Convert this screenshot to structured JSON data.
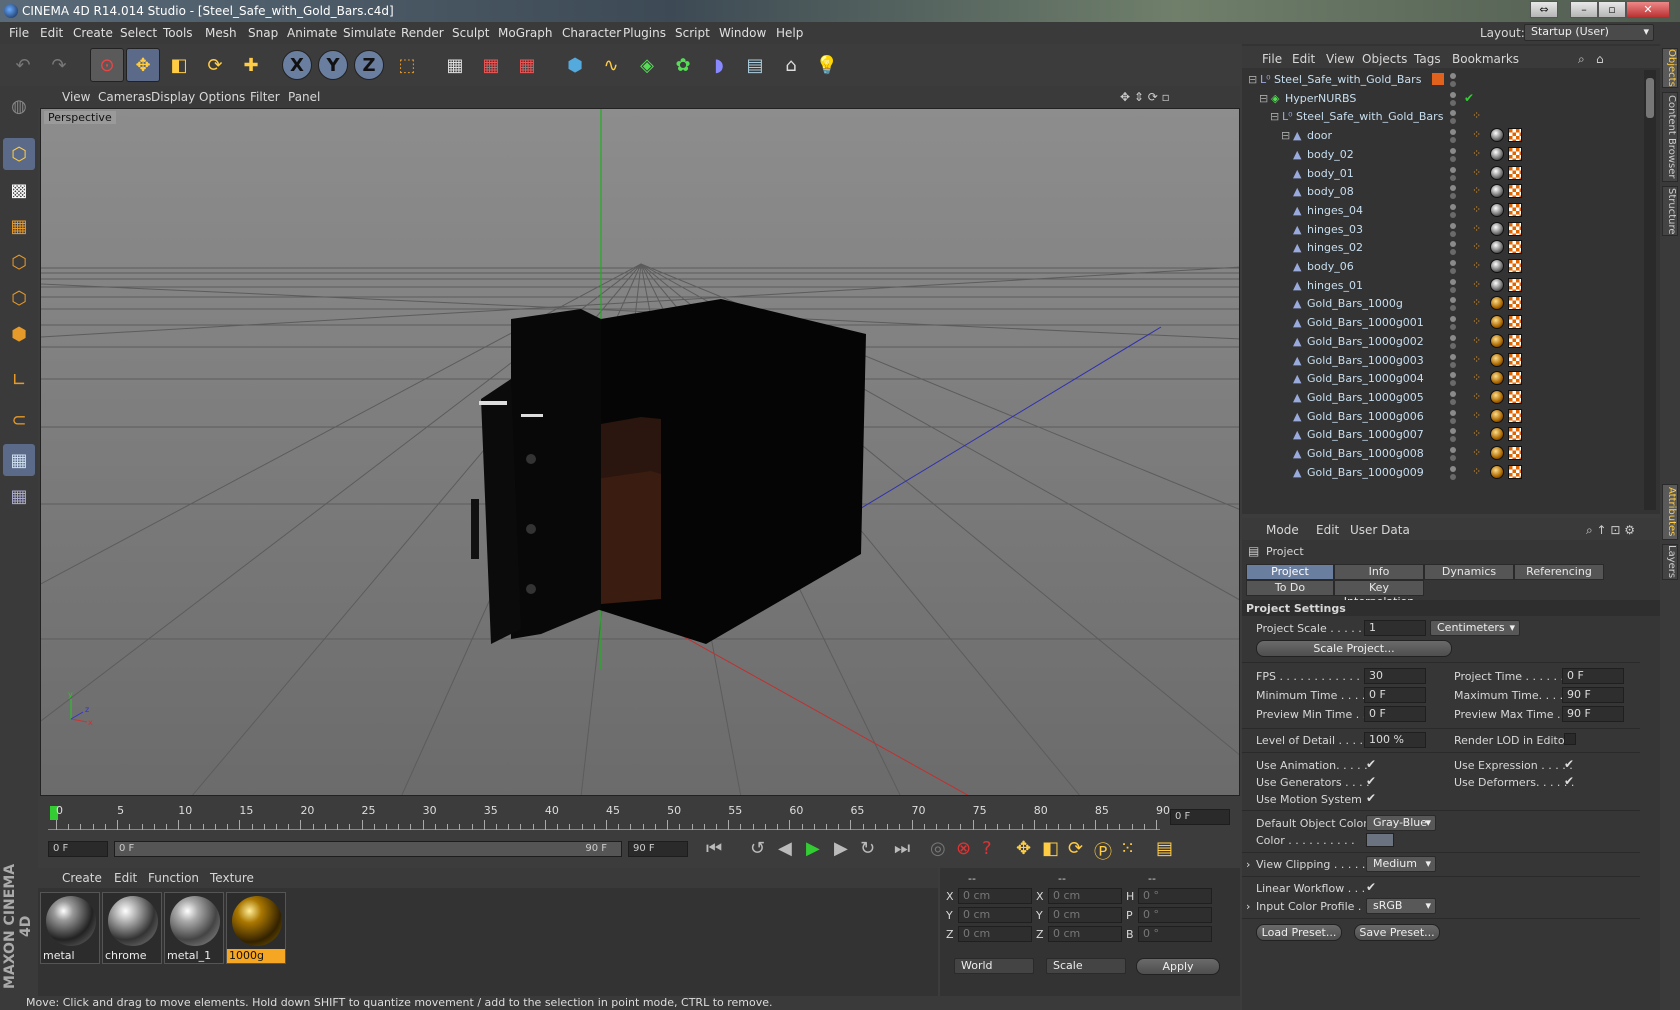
{
  "window": {
    "title": "CINEMA 4D R14.014 Studio - [Steel_Safe_with_Gold_Bars.c4d]"
  },
  "menu": [
    "File",
    "Edit",
    "Create",
    "Select",
    "Tools",
    "Mesh",
    "Snap",
    "Animate",
    "Simulate",
    "Render",
    "Sculpt",
    "MoGraph",
    "Character",
    "Plugins",
    "Script",
    "Window",
    "Help"
  ],
  "layout": {
    "label": "Layout:",
    "value": "Startup (User)"
  },
  "viewport": {
    "menu": [
      "View",
      "Cameras",
      "Display",
      "Options",
      "Filter",
      "Panel"
    ],
    "label": "Perspective"
  },
  "timeline": {
    "ticks": [
      "0",
      "5",
      "10",
      "15",
      "20",
      "25",
      "30",
      "35",
      "40",
      "45",
      "50",
      "55",
      "60",
      "65",
      "70",
      "75",
      "80",
      "85",
      "90"
    ],
    "current_frame": "0 F",
    "start": "0 F",
    "range_start": "0 F",
    "range_end": "90 F",
    "end": "90 F"
  },
  "materials": {
    "menu": [
      "Create",
      "Edit",
      "Function",
      "Texture"
    ],
    "items": [
      {
        "name": "metal"
      },
      {
        "name": "chrome"
      },
      {
        "name": "metal_1"
      },
      {
        "name": "1000g"
      }
    ]
  },
  "coords": {
    "headers": [
      "--",
      "--",
      "--"
    ],
    "rows": [
      {
        "a": "X",
        "av": "0 cm",
        "b": "X",
        "bv": "0 cm",
        "c": "H",
        "cv": "0 °"
      },
      {
        "a": "Y",
        "av": "0 cm",
        "b": "Y",
        "bv": "0 cm",
        "c": "P",
        "cv": "0 °"
      },
      {
        "a": "Z",
        "av": "0 cm",
        "b": "Z",
        "bv": "0 cm",
        "c": "B",
        "cv": "0 °"
      }
    ],
    "mode1": "World",
    "mode2": "Scale",
    "apply": "Apply"
  },
  "status": "Move: Click and drag to move elements. Hold down SHIFT to quantize movement / add to the selection in point mode, CTRL to remove.",
  "objects": {
    "menu": [
      "File",
      "Edit",
      "View",
      "Objects",
      "Tags",
      "Bookmarks"
    ],
    "rows": [
      {
        "name": "Steel_Safe_with_Gold_Bars",
        "indent": 0
      },
      {
        "name": "HyperNURBS",
        "indent": 1
      },
      {
        "name": "Steel_Safe_with_Gold_Bars",
        "indent": 2
      },
      {
        "name": "door",
        "indent": 3
      },
      {
        "name": "body_02",
        "indent": 3
      },
      {
        "name": "body_01",
        "indent": 3
      },
      {
        "name": "body_08",
        "indent": 3
      },
      {
        "name": "hinges_04",
        "indent": 3
      },
      {
        "name": "hinges_03",
        "indent": 3
      },
      {
        "name": "hinges_02",
        "indent": 3
      },
      {
        "name": "body_06",
        "indent": 3
      },
      {
        "name": "hinges_01",
        "indent": 3
      },
      {
        "name": "Gold_Bars_1000g",
        "indent": 3
      },
      {
        "name": "Gold_Bars_1000g001",
        "indent": 3
      },
      {
        "name": "Gold_Bars_1000g002",
        "indent": 3
      },
      {
        "name": "Gold_Bars_1000g003",
        "indent": 3
      },
      {
        "name": "Gold_Bars_1000g004",
        "indent": 3
      },
      {
        "name": "Gold_Bars_1000g005",
        "indent": 3
      },
      {
        "name": "Gold_Bars_1000g006",
        "indent": 3
      },
      {
        "name": "Gold_Bars_1000g007",
        "indent": 3
      },
      {
        "name": "Gold_Bars_1000g008",
        "indent": 3
      },
      {
        "name": "Gold_Bars_1000g009",
        "indent": 3
      }
    ]
  },
  "attributes": {
    "menu": [
      "Mode",
      "Edit",
      "User Data"
    ],
    "object": "Project",
    "tabs": [
      "Project Settings",
      "Info",
      "Dynamics",
      "Referencing",
      "To Do",
      "Key Interpolation"
    ],
    "section": "Project Settings",
    "project_scale_label": "Project Scale . . . . . .",
    "project_scale": "1",
    "units": "Centimeters",
    "scale_project": "Scale Project...",
    "fps_label": "FPS . . . . . . . . . . . . . .",
    "fps": "30",
    "project_time_label": "Project Time . . . . . . .",
    "project_time": "0 F",
    "min_time_label": "Minimum Time . . . . .",
    "min_time": "0 F",
    "max_time_label": "Maximum Time. . . . .",
    "max_time": "90 F",
    "prev_min_label": "Preview Min Time . .",
    "prev_min": "0 F",
    "prev_max_label": "Preview Max Time . .",
    "prev_max": "90 F",
    "lod_label": "Level of Detail . . . . .",
    "lod": "100 %",
    "render_lod_label": "Render LOD in Editor",
    "use_anim_label": "Use Animation. . . . .",
    "use_expr_label": "Use Expression . . . . .",
    "use_gen_label": "Use Generators . . . .",
    "use_def_label": "Use Deformers. . . . . .",
    "use_motion_label": "Use Motion System",
    "def_color_label": "Default Object Color",
    "def_color": "Gray-Blue",
    "color_label": "Color . . . . . . . . . .",
    "view_clip_label": "View Clipping . . . . .",
    "view_clip": "Medium",
    "linear_label": "Linear Workflow . . .",
    "input_profile_label": "Input Color Profile .",
    "input_profile": "sRGB",
    "load_preset": "Load Preset...",
    "save_preset": "Save Preset..."
  },
  "side_tabs": [
    "Objects",
    "Content Browser",
    "Structure",
    "Attributes",
    "Layers"
  ],
  "brand": "MAXON CINEMA 4D"
}
